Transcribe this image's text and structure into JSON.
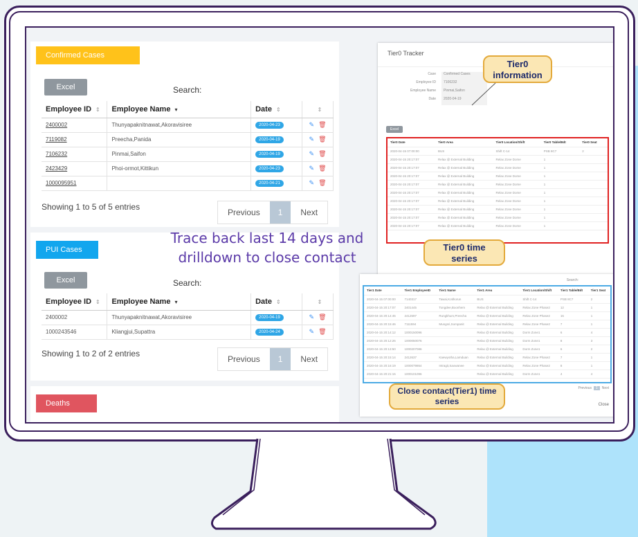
{
  "confirmed": {
    "title": "Confirmed Cases",
    "excel": "Excel",
    "search": "Search:",
    "headers": [
      "Employee ID",
      "Employee Name",
      "Date",
      ""
    ],
    "rows": [
      {
        "id": "2400002",
        "name": "Thunyapaknitnawat,Akoravisiree",
        "date": "2020-04-23"
      },
      {
        "id": "7119082",
        "name": "Preecha,Panida",
        "date": "2020-04-19"
      },
      {
        "id": "7106232",
        "name": "Pinmai,Saifon",
        "date": "2020-04-19"
      },
      {
        "id": "2423429",
        "name": "Phoi-ormot,Kittikun",
        "date": "2020-04-23"
      },
      {
        "id": "1000095951",
        "name": "",
        "date": "2020-04-21"
      }
    ],
    "showing": "Showing 1 to 5 of 5 entries",
    "prev": "Previous",
    "page": "1",
    "next": "Next"
  },
  "pui": {
    "title": "PUI Cases",
    "excel": "Excel",
    "search": "Search:",
    "headers": [
      "Employee ID",
      "Employee Name",
      "Date",
      ""
    ],
    "rows": [
      {
        "id": "2400002",
        "name": "Thunyapaknitnawat,Akoravisiree",
        "date": "2020-04-19"
      },
      {
        "id": "1000243546",
        "name": "Kliangjui,Supattra",
        "date": "2020-04-24"
      }
    ],
    "showing": "Showing 1 to 2 of 2 entries",
    "prev": "Previous",
    "page": "1",
    "next": "Next"
  },
  "deaths": {
    "title": "Deaths"
  },
  "annotation": {
    "line1": "Trace back last 14 days and",
    "line2": "drilldown to close contact"
  },
  "tier0": {
    "title": "Tier0 Tracker",
    "fields": [
      {
        "label": "Case",
        "value": "Confirmed Cases"
      },
      {
        "label": "Employee ID",
        "value": "7106232"
      },
      {
        "label": "Employee Name",
        "value": "Pinmai,Saifon"
      },
      {
        "label": "Date",
        "value": "2020-04-19"
      }
    ],
    "excel": "Excel",
    "headers": [
      "Tier0 Date",
      "Tier0 Area",
      "Tier0 Location/Shift",
      "Tier0 Table/Bdt",
      "Tier0 Seat"
    ],
    "rows": [
      [
        "2020-04-15 07:00:00",
        "BUS",
        "Shift C-14",
        "PSB 8C7",
        "2"
      ],
      [
        "2020-04-15 20:17:07",
        "Relax @ External Building",
        "Relax Zone Dome",
        "1",
        ""
      ],
      [
        "2020-04-15 20:17:07",
        "Relax @ External Building",
        "Relax Zone Dome",
        "1",
        ""
      ],
      [
        "2020-04-15 20:17:07",
        "Relax @ External Building",
        "Relax Zone Dome",
        "1",
        ""
      ],
      [
        "2020-04-15 20:17:07",
        "Relax @ External Building",
        "Relax Zone Dome",
        "1",
        ""
      ],
      [
        "2020-04-15 20:17:07",
        "Relax @ External Building",
        "Relax Zone Dome",
        "1",
        ""
      ],
      [
        "2020-04-15 20:17:07",
        "Relax @ External Building",
        "Relax Zone Dome",
        "1",
        ""
      ],
      [
        "2020-04-15 20:17:07",
        "Relax @ External Building",
        "Relax Zone Dome",
        "1",
        ""
      ],
      [
        "2020-04-15 20:17:07",
        "Relax @ External Building",
        "Relax Zone Dome",
        "1",
        ""
      ],
      [
        "2020-04-15 20:17:07",
        "Relax @ External Building",
        "Relax Zone Dome",
        "1",
        ""
      ]
    ],
    "callout_info": "Tier0 information",
    "callout_series": "Tier0 time series"
  },
  "tier1": {
    "search": "Search:",
    "headers": [
      "Tier1 Date",
      "Tier1 EmployeeID",
      "Tier1 Name",
      "Tier1 Area",
      "Tier1 Location/Shift",
      "Tier1 Table/Bdt",
      "Tier1 Seat"
    ],
    "rows": [
      [
        "2020-04-15 07:00:00",
        "7140317",
        "Tawai,Kotihorun",
        "BUS",
        "Shift C-14",
        "PSB 8C7",
        "2"
      ],
      [
        "2020-04-15 20:17:07",
        "2401445",
        "Tongdee,Boonhem",
        "Relax @ External Building",
        "Relax Zone Phase2",
        "12",
        "1"
      ],
      [
        "2020-04-15 20:14:45",
        "2412597",
        "Rungkhum,Preecha",
        "Relax @ External Building",
        "Relax Zone Phase2",
        "15",
        "1"
      ],
      [
        "2020-04-15 20:15:46",
        "7111594",
        "Mungsri,Sompanit",
        "Relax @ External Building",
        "Relax Zone Phase2",
        "7",
        "1"
      ],
      [
        "2020-04-15 20:14:12",
        "1000150096",
        "",
        "Relax @ External Building",
        "Dorm Zone1",
        "6",
        "4"
      ],
      [
        "2020-04-15 20:12:26",
        "1000050076",
        "",
        "Relax @ External Building",
        "Dorm Zone1",
        "8",
        "3"
      ],
      [
        "2020-04-15 20:13:50",
        "1000207086",
        "",
        "Relax @ External Building",
        "Dorm Zone1",
        "6",
        "2"
      ],
      [
        "2020-04-15 20:15:14",
        "2412637",
        "Kaewyotha,Lamduan",
        "Relax @ External Building",
        "Relax Zone Phase2",
        "7",
        "1"
      ],
      [
        "2020-04-15 20:16:19",
        "1000079864",
        "Intragit,Saowanee",
        "Relax @ External Building",
        "Relax Zone Phase2",
        "8",
        "1"
      ],
      [
        "2020-04-15 20:21:15",
        "1000101096",
        "",
        "Relax @ External Building",
        "Dorm Zone1",
        "4",
        "4"
      ]
    ],
    "pager": [
      "Previous",
      "1",
      "Next"
    ],
    "close": "Close",
    "callout": "Close contact(Tier1) time series"
  }
}
